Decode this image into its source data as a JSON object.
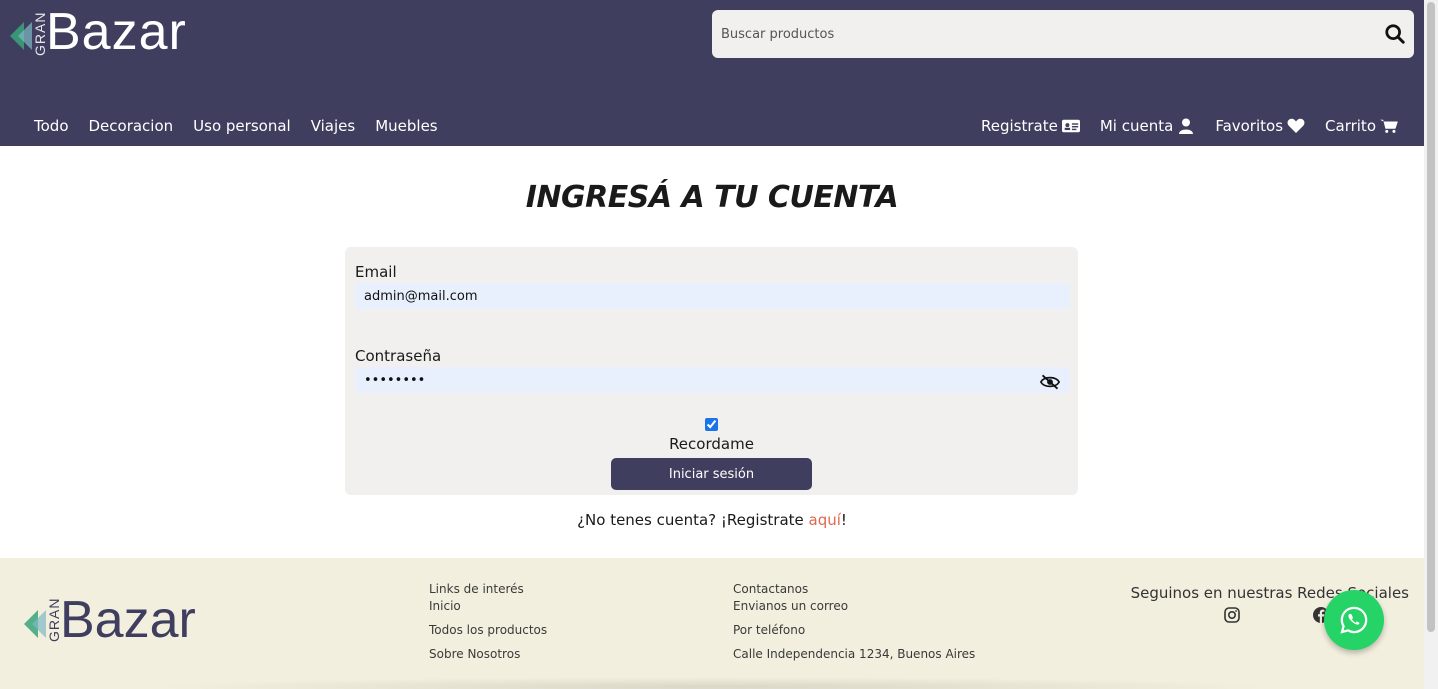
{
  "header": {
    "logo_small": "GRAN",
    "logo_big": "Bazar",
    "search_placeholder": "Buscar productos",
    "nav_left": [
      "Todo",
      "Decoracion",
      "Uso personal",
      "Viajes",
      "Muebles"
    ],
    "nav_right": [
      {
        "label": "Registrate",
        "icon": "id-card-icon"
      },
      {
        "label": "Mi cuenta",
        "icon": "user-icon"
      },
      {
        "label": "Favoritos",
        "icon": "heart-icon"
      },
      {
        "label": "Carrito",
        "icon": "cart-icon"
      }
    ]
  },
  "login": {
    "title": "INGRESÁ A TU CUENTA",
    "email_label": "Email",
    "email_value": "admin@mail.com",
    "password_label": "Contraseña",
    "password_value": "••••••••",
    "remember_label": "Recordame",
    "remember_checked": true,
    "submit_label": "Iniciar sesión",
    "register_prefix": "¿No tenes cuenta? ¡Registrate ",
    "register_link": "aquí",
    "register_suffix": "!"
  },
  "footer": {
    "logo_small": "GRAN",
    "logo_big": "Bazar",
    "links_title": "Links de interés",
    "links": [
      "Inicio",
      "Todos los productos",
      "Sobre Nosotros"
    ],
    "contact_title": "Contactanos",
    "contact": [
      "Envianos un correo",
      "Por teléfono",
      "Calle Independencia 1234, Buenos Aires"
    ],
    "social_title": "Seguinos en nuestras Redes Sociales",
    "social_icons": [
      "instagram-icon",
      "facebook-icon"
    ]
  },
  "colors": {
    "header_bg": "#3f3e5e",
    "footer_bg": "#f2efde",
    "card_bg": "#f1f0ee",
    "accent_link": "#e0694b",
    "whatsapp": "#25d366"
  }
}
